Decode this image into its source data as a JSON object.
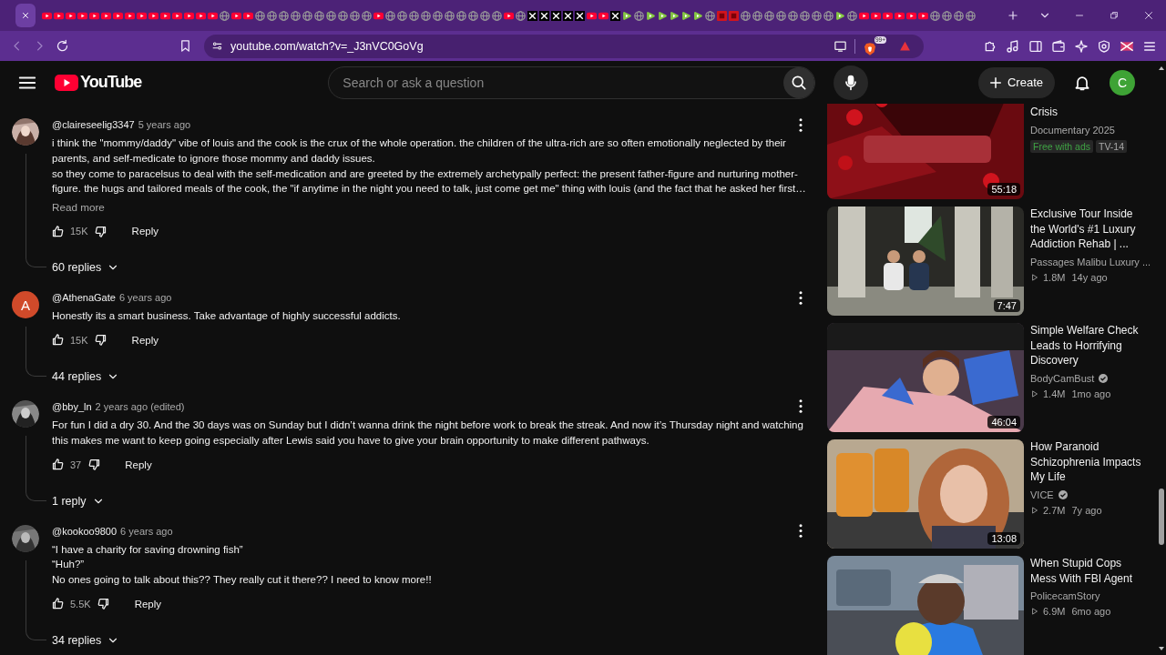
{
  "browser": {
    "tabs": [
      {
        "selected": true
      },
      {
        "kind": "youtube",
        "selected": false
      },
      {
        "kind": "youtube",
        "selected": false
      },
      {
        "kind": "youtube",
        "selected": false
      },
      {
        "kind": "youtube",
        "selected": false
      },
      {
        "kind": "youtube",
        "selected": false
      },
      {
        "kind": "youtube",
        "selected": false
      },
      {
        "kind": "youtube",
        "selected": false
      },
      {
        "kind": "youtube",
        "selected": false
      },
      {
        "kind": "youtube",
        "selected": false
      },
      {
        "kind": "youtube",
        "selected": false
      },
      {
        "kind": "youtube",
        "selected": false
      },
      {
        "kind": "youtube",
        "selected": false
      },
      {
        "kind": "youtube",
        "selected": false
      },
      {
        "kind": "youtube",
        "selected": false
      },
      {
        "kind": "youtube",
        "selected": false
      },
      {
        "kind": "globe",
        "selected": false
      },
      {
        "kind": "youtube",
        "selected": false
      },
      {
        "kind": "youtube",
        "selected": false
      },
      {
        "kind": "globe",
        "selected": false
      },
      {
        "kind": "globe",
        "selected": false
      },
      {
        "kind": "globe",
        "selected": false
      },
      {
        "kind": "globe",
        "selected": false
      },
      {
        "kind": "globe",
        "selected": false
      },
      {
        "kind": "globe",
        "selected": false
      },
      {
        "kind": "globe",
        "selected": false
      },
      {
        "kind": "globe",
        "selected": false
      },
      {
        "kind": "globe",
        "selected": false
      },
      {
        "kind": "globe",
        "selected": false
      },
      {
        "kind": "youtube",
        "selected": false
      },
      {
        "kind": "globe",
        "selected": false
      },
      {
        "kind": "globe",
        "selected": false
      },
      {
        "kind": "globe",
        "selected": false
      },
      {
        "kind": "globe",
        "selected": false
      },
      {
        "kind": "globe",
        "selected": false
      },
      {
        "kind": "globe",
        "selected": false
      },
      {
        "kind": "globe",
        "selected": false
      },
      {
        "kind": "globe",
        "selected": false
      },
      {
        "kind": "globe",
        "selected": false
      },
      {
        "kind": "globe",
        "selected": false
      },
      {
        "kind": "youtube",
        "selected": false
      },
      {
        "kind": "globe",
        "selected": false
      },
      {
        "kind": "x",
        "selected": false
      },
      {
        "kind": "x",
        "selected": false
      },
      {
        "kind": "x",
        "selected": false
      },
      {
        "kind": "x",
        "selected": false
      },
      {
        "kind": "x",
        "selected": false
      },
      {
        "kind": "youtube",
        "selected": false
      },
      {
        "kind": "youtube",
        "selected": false
      },
      {
        "kind": "x",
        "selected": false
      },
      {
        "kind": "rumble",
        "selected": false
      },
      {
        "kind": "globe",
        "selected": false
      },
      {
        "kind": "rumble",
        "selected": false
      },
      {
        "kind": "rumble",
        "selected": false
      },
      {
        "kind": "rumble",
        "selected": false
      },
      {
        "kind": "rumble",
        "selected": false
      },
      {
        "kind": "rumble",
        "selected": false
      },
      {
        "kind": "globe",
        "selected": false
      },
      {
        "kind": "square",
        "selected": false
      },
      {
        "kind": "square",
        "selected": false
      },
      {
        "kind": "globe",
        "selected": false
      },
      {
        "kind": "globe",
        "selected": false
      },
      {
        "kind": "globe",
        "selected": false
      },
      {
        "kind": "globe",
        "selected": false
      },
      {
        "kind": "globe",
        "selected": false
      },
      {
        "kind": "globe",
        "selected": false
      },
      {
        "kind": "globe",
        "selected": false
      },
      {
        "kind": "globe",
        "selected": false
      },
      {
        "kind": "rumble",
        "selected": false
      },
      {
        "kind": "globe",
        "selected": false
      },
      {
        "kind": "youtube",
        "selected": false
      },
      {
        "kind": "youtube",
        "selected": false
      },
      {
        "kind": "youtube",
        "selected": false
      },
      {
        "kind": "youtube",
        "selected": false
      },
      {
        "kind": "youtube",
        "selected": false
      },
      {
        "kind": "youtube",
        "selected": false
      },
      {
        "kind": "globe",
        "selected": false
      },
      {
        "kind": "globe",
        "selected": false
      },
      {
        "kind": "globe",
        "selected": false
      },
      {
        "kind": "globe",
        "selected": false
      }
    ],
    "back": {
      "disabled": true
    },
    "forward": {
      "disabled": true
    },
    "url": "youtube.com/watch?v=_J3nVC0GoVg",
    "shields_badge": "99+"
  },
  "header": {
    "logo": "YouTube",
    "search": {
      "placeholder": "Search or ask a question"
    },
    "create": "Create",
    "avatar": "C"
  },
  "comments": [
    {
      "avatar": {
        "kind": "picture"
      },
      "author": "@claireseelig3347",
      "time": "5 years ago",
      "paragraphs": [
        "i think the \"mommy/daddy\" vibe of louis and the cook is the crux of the whole operation. the children of the ultra-rich are so often emotionally neglected by their parents, and self-medicate to ignore those mommy and daddy issues.",
        "so they come to paracelsus to deal with the self-medication and are greeted by the extremely archetypally perfect: the present father-figure and nurturing mother-figure. the hugs and tailored meals of the cook, the \"if anytime in the night you need to talk, just come get me\" thing with louis (and the fact that he asked her first…"
      ],
      "read_more": "Read more",
      "likes": "15K",
      "reply": "Reply",
      "replies": "60 replies"
    },
    {
      "avatar": {
        "kind": "letter",
        "letter": "A",
        "color": "#d04a2a"
      },
      "author": "@AthenaGate",
      "time": "6 years ago",
      "paragraphs": [
        "Honestly its a smart business. Take advantage of highly successful addicts."
      ],
      "likes": "15K",
      "reply": "Reply",
      "replies": "44 replies"
    },
    {
      "avatar": {
        "kind": "picture"
      },
      "author": "@bby_ln",
      "time": "2 years ago (edited)",
      "paragraphs": [
        "For fun I did a dry 30. And the 30 days was on Sunday but I didn’t wanna drink the night before work to break the streak. And now it’s Thursday night and watching this makes me want to keep going especially after Lewis said you have to give your brain opportunity to make different pathways."
      ],
      "likes": "37",
      "reply": "Reply",
      "replies": "1 reply"
    },
    {
      "avatar": {
        "kind": "picture"
      },
      "author": "@kookoo9800",
      "time": "6 years ago",
      "paragraphs": [
        "“I have a charity for saving drowning fish”",
        "“Huh?”",
        "No ones going to talk about this??  They really cut it there?? I need to know more!!"
      ],
      "likes": "5.5K",
      "reply": "Reply",
      "replies": "34 replies"
    }
  ],
  "sidebar": [
    {
      "kind": "movie",
      "title": "Crisis",
      "subtitle": "Documentary 2025",
      "badges": [
        {
          "kind": "offer",
          "text": "Free with ads"
        },
        {
          "kind": "rating",
          "text": "TV-14"
        }
      ],
      "duration": "55:18"
    },
    {
      "kind": "video",
      "title": "Exclusive Tour Inside the World's #1 Luxury Addiction Rehab | ...",
      "channel": "Passages Malibu Luxury ...",
      "verified": false,
      "views": "1.8M",
      "age": "14y ago",
      "duration": "7:47"
    },
    {
      "kind": "video",
      "title": "Simple Welfare Check Leads to Horrifying Discovery",
      "channel": "BodyCamBust",
      "verified": true,
      "views": "1.4M",
      "age": "1mo ago",
      "duration": "46:04"
    },
    {
      "kind": "video",
      "title": "How Paranoid Schizophrenia Impacts My Life",
      "channel": "VICE",
      "verified": true,
      "views": "2.7M",
      "age": "7y ago",
      "duration": "13:08"
    },
    {
      "kind": "video",
      "title": "When Stupid Cops Mess With FBI Agent",
      "channel": "PolicecamStory",
      "verified": false,
      "views": "6.9M",
      "age": "6mo ago"
    }
  ]
}
